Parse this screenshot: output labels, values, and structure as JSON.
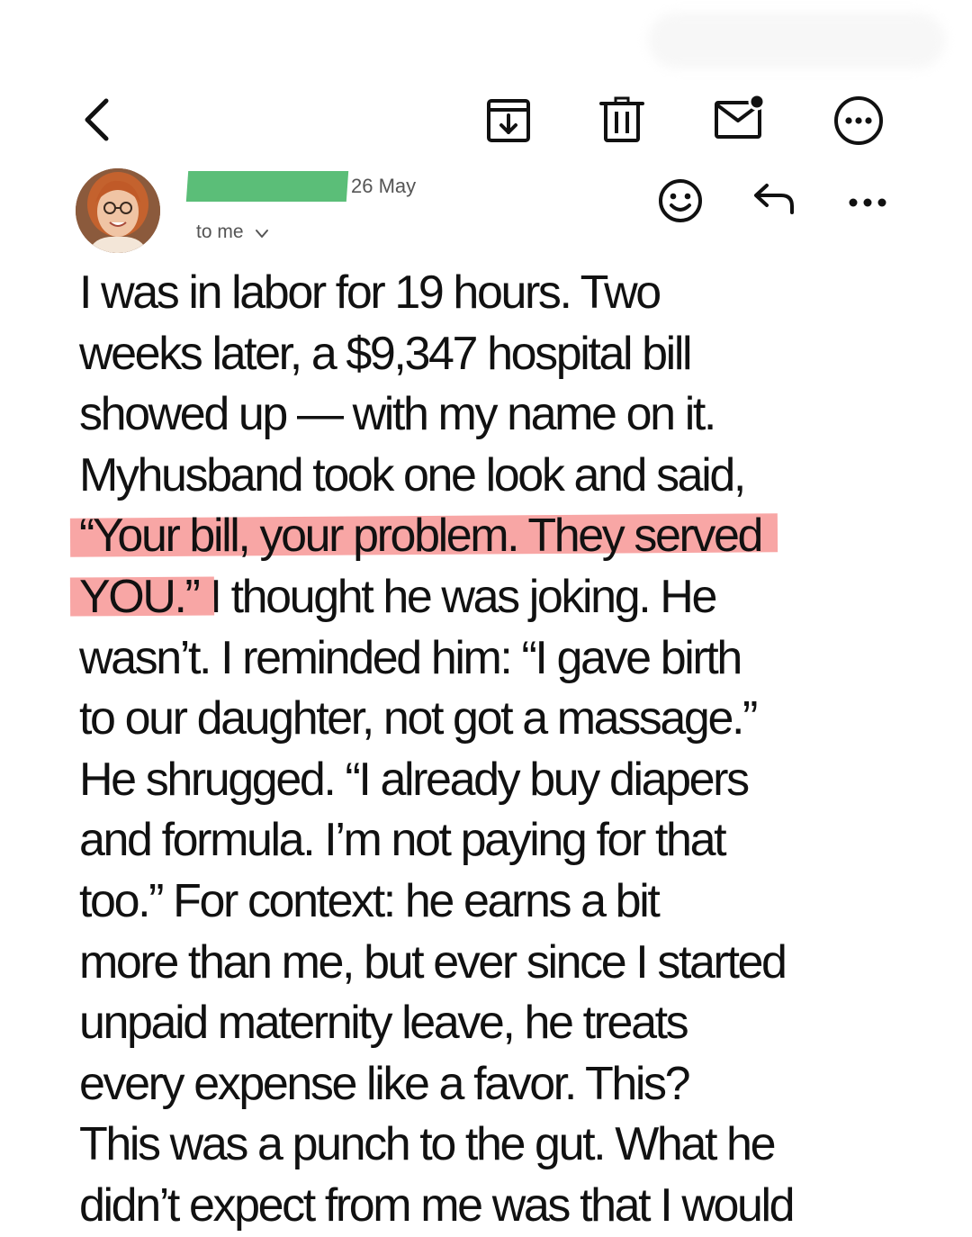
{
  "toolbar": {
    "back_icon": "chevron-left-icon",
    "archive_icon": "archive-download-icon",
    "trash_icon": "trash-icon",
    "mark_unread_icon": "mail-unread-icon",
    "more_icon": "more-circle-icon"
  },
  "message": {
    "date": "26 May",
    "recipient": "to me",
    "sender_name_redaction_color": "#5bbe78",
    "highlight_color": "#f8a6a5",
    "actions": [
      "smiley-icon",
      "reply-icon",
      "more-dots-icon"
    ]
  },
  "body": {
    "lines": [
      {
        "pre": "I was in labor for 19 hours. Two"
      },
      {
        "pre": "weeks later, a $9,347 hospital bill"
      },
      {
        "pre": "showed up — with my name on it."
      },
      {
        "pre": "Myhusband took one look and said,"
      },
      {
        "hl": "“Your bill, your problem. They served"
      },
      {
        "hl": "YOU.”",
        "post": " I thought he was joking. He"
      },
      {
        "pre": "wasn’t. I reminded him: “I gave birth"
      },
      {
        "pre": "to our daughter, not got a massage.”"
      },
      {
        "pre": "He shrugged. “I already buy diapers"
      },
      {
        "pre": "and formula. I’m not paying for that"
      },
      {
        "pre": "too.” For context: he earns a bit"
      },
      {
        "pre": "more than me, but ever since I started"
      },
      {
        "pre": "unpaid maternity leave, he treats"
      },
      {
        "pre": "every expense like a favor. This?"
      },
      {
        "pre": "This was a punch to the gut. What he"
      },
      {
        "pre": "didn’t expect from me was that I would"
      }
    ]
  }
}
